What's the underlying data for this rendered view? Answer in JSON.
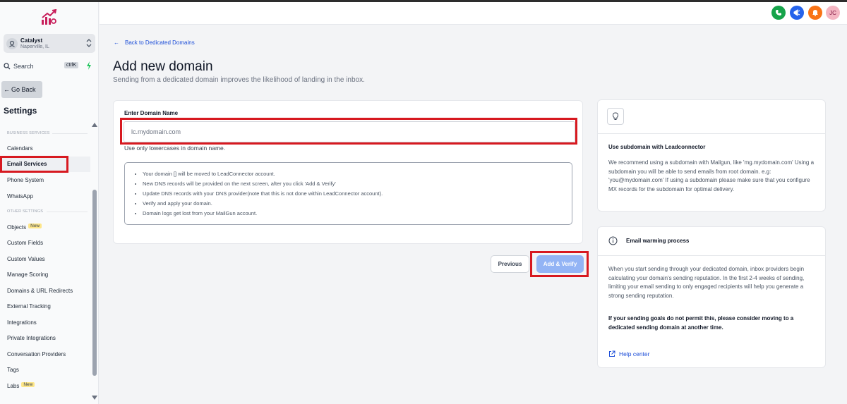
{
  "sidebar": {
    "account": {
      "name": "Catalyst",
      "location": "Naperville, IL"
    },
    "search": {
      "label": "Search",
      "shortcut": "ctrlK"
    },
    "go_back": "Go Back",
    "settings_title": "Settings",
    "sections": {
      "business": "BUSINESS SERVICES",
      "other": "OTHER SETTINGS"
    },
    "items": [
      {
        "label": "Calendars"
      },
      {
        "label": "Email Services"
      },
      {
        "label": "Phone System"
      },
      {
        "label": "WhatsApp"
      },
      {
        "label": "Objects",
        "badge": "New"
      },
      {
        "label": "Custom Fields"
      },
      {
        "label": "Custom Values"
      },
      {
        "label": "Manage Scoring"
      },
      {
        "label": "Domains & URL Redirects"
      },
      {
        "label": "External Tracking"
      },
      {
        "label": "Integrations"
      },
      {
        "label": "Private Integrations"
      },
      {
        "label": "Conversation Providers"
      },
      {
        "label": "Tags"
      },
      {
        "label": "Labs",
        "badge": "New"
      }
    ]
  },
  "topbar": {
    "avatar_initials": "JC",
    "colors": {
      "phone": "#16a34a",
      "megaphone": "#2563eb",
      "bell": "#f97316"
    }
  },
  "main": {
    "back_link": "Back to Dedicated Domains",
    "title": "Add new domain",
    "subtitle": "Sending from a dedicated domain improves the likelihood of landing in the inbox.",
    "form": {
      "label": "Enter Domain Name",
      "placeholder": "lc.mydomain.com",
      "hint": "Use only lowercases in domain name.",
      "notes": [
        "Your domain [] will be moved to LeadConnector account.",
        "New DNS records will be provided on the next screen, after you click 'Add & Verify'",
        "Update DNS records with your DNS provider(note that this is not done within LeadConnector account).",
        "Verify and apply your domain.",
        "Domain logs get lost from your MailGun account."
      ]
    },
    "buttons": {
      "previous": "Previous",
      "add_verify": "Add & Verify"
    }
  },
  "aside": {
    "subdomain": {
      "title": "Use subdomain with Leadconnector",
      "text": "We recommend using a subdomain with Mailgun, like 'mg.mydomain.com' Using a subdomain you will be able to send emails from root domain. e.g: 'you@mydomain.com' If using a subdomain please make sure that you configure MX records for the subdomain for optimal delivery."
    },
    "warming": {
      "title": "Email warming process",
      "text": "When you start sending through your dedicated domain, inbox providers begin calculating your domain's sending reputation. In the first 2-4 weeks of sending, limiting your email sending to only engaged recipients will help you generate a strong sending reputation.",
      "bold_text": "If your sending goals do not permit this, please consider moving to a dedicated sending domain at another time.",
      "help_link": "Help center"
    }
  },
  "highlight_color": "#d71920"
}
